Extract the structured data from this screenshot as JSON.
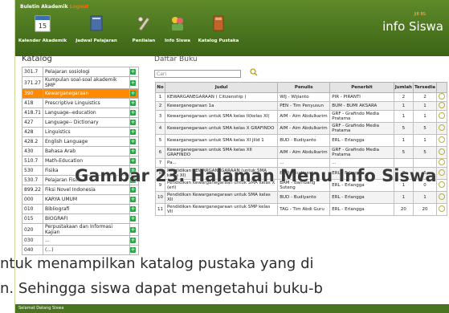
{
  "top": {
    "title": "Buletin Akademik",
    "logout": "Logout",
    "brand_small": "JIB BS",
    "brand": "info Siswa"
  },
  "nav": [
    {
      "label": "Kalender Akademik",
      "icon": "calendar-icon",
      "day": "15"
    },
    {
      "label": "Jadwal Pelajaran",
      "icon": "schedule-book-icon"
    },
    {
      "label": "Penilaian",
      "icon": "grading-tools-icon"
    },
    {
      "label": "Info Siswa",
      "icon": "student-info-icon"
    },
    {
      "label": "Katalog Pustaka",
      "icon": "library-book-icon"
    }
  ],
  "katalog": {
    "title": "Katalog",
    "items": [
      {
        "code": "301.7",
        "label": "Pelajaran sosiologi"
      },
      {
        "code": "371.27",
        "label": "Kumpulan soal-soal akademik SMP"
      },
      {
        "code": "390",
        "label": "Kewarganegaraan"
      },
      {
        "code": "418",
        "label": "Prescriptive Linguistics"
      },
      {
        "code": "418.71",
        "label": "Language--education"
      },
      {
        "code": "427",
        "label": "Language-- Dictionary"
      },
      {
        "code": "428",
        "label": "Linguistics"
      },
      {
        "code": "428.2",
        "label": "English Language"
      },
      {
        "code": "430",
        "label": "Bahasa Arab"
      },
      {
        "code": "510.7",
        "label": "Math-Education"
      },
      {
        "code": "530",
        "label": "Fisika"
      },
      {
        "code": "530.7",
        "label": "Pelajaran Fisika"
      },
      {
        "code": "899.22",
        "label": "Fiksi Novel Indonesia"
      },
      {
        "code": "000",
        "label": "KARYA UMUM"
      },
      {
        "code": "010",
        "label": "Bibliografi"
      },
      {
        "code": "015",
        "label": "BIOGRAFI"
      },
      {
        "code": "020",
        "label": "Perpustakaan dan Informasi Kajian"
      },
      {
        "code": "030",
        "label": "..."
      },
      {
        "code": "040",
        "label": "(...)"
      }
    ]
  },
  "daftar": {
    "title": "Daftar Buku",
    "search_placeholder": "Cari",
    "headers": [
      "No",
      "Judul",
      "Penulis",
      "Penerbit",
      "Jumlah",
      "Tersedia"
    ],
    "rows": [
      {
        "no": "1",
        "judul": "KEWARGANEGARAAN ( Citizenship )",
        "penulis": "WIJ - Wijianto",
        "penerbit": "PIR - PIRANTI",
        "jumlah": "2",
        "tersedia": "2"
      },
      {
        "no": "2",
        "judul": "Kewarganegaraan 1a",
        "penulis": "PEN - Tim Penyusun",
        "penerbit": "BUM - BUMI AKSARA",
        "jumlah": "1",
        "tersedia": "1"
      },
      {
        "no": "3",
        "judul": "Kewarganegaraan untuk SMA kelas II(kelas XI)",
        "penulis": "AIM - Aim Abdulkarim",
        "penerbit": "GRF - Grafindo Media Pratama",
        "jumlah": "1",
        "tersedia": "1"
      },
      {
        "no": "4",
        "judul": "Kewarganegaraan untuk SMA kelas X GRAFINDO",
        "penulis": "AIM - Aim Abdulkarim",
        "penerbit": "GRF - Grafindo Media Pratama",
        "jumlah": "5",
        "tersedia": "5"
      },
      {
        "no": "5",
        "judul": "Kewarganegaraan untuk SMA kelas XI jilid 1",
        "penulis": "BUD - Budiyanto",
        "penerbit": "ERL - Erlangga",
        "jumlah": "1",
        "tersedia": "1"
      },
      {
        "no": "6",
        "judul": "Kewarganegaraan untuk SMA kelas XII GRAFINDO",
        "penulis": "AIM - Aim Abdulkarim",
        "penerbit": "GRF - Grafindo Media Pratama",
        "jumlah": "5",
        "tersedia": "5"
      },
      {
        "no": "7",
        "judul": "Pa...",
        "penulis": "...",
        "penerbit": "...",
        "jumlah": "",
        "tersedia": ""
      },
      {
        "no": "8",
        "judul": "Pendidikan KEWARGANEGARAAN (untuk SMA kelas XI)",
        "penulis": "BUD - Budiyanto",
        "penerbit": "ERL - Erlangga",
        "jumlah": "7",
        "tersedia": "5"
      },
      {
        "no": "9",
        "judul": "Pendidikan Kewarganegaraan untuk SMA kelas X (erl)",
        "penulis": "BAM - Bambang Suteng",
        "penerbit": "ERL - Erlangga",
        "jumlah": "1",
        "tersedia": "0"
      },
      {
        "no": "10",
        "judul": "Pendidikan Kewarganegaraan untuk SMA kelas XII",
        "penulis": "BUD - Budiyanto",
        "penerbit": "ERL - Erlangga",
        "jumlah": "1",
        "tersedia": "1"
      },
      {
        "no": "11",
        "judul": "Pendidikan Kewarganegaraan untuk SMP kelas VII",
        "penulis": "TAG - Tim Abdi Guru",
        "penerbit": "ERL - Erlangga",
        "jumlah": "20",
        "tersedia": "20"
      }
    ]
  },
  "status": "Selamat Datang Siswa",
  "overlay": {
    "caption": "Gambar 23. Halaman Menu Info Siswa",
    "line1": "ntuk menampilkan katalog pustaka yang di",
    "line2": "n. Sehingga siswa dapat mengetahui buku-b"
  },
  "colors": {
    "header_green": "#4a7420",
    "selected_orange": "#ff8a00",
    "add_green": "#2fa44a"
  }
}
